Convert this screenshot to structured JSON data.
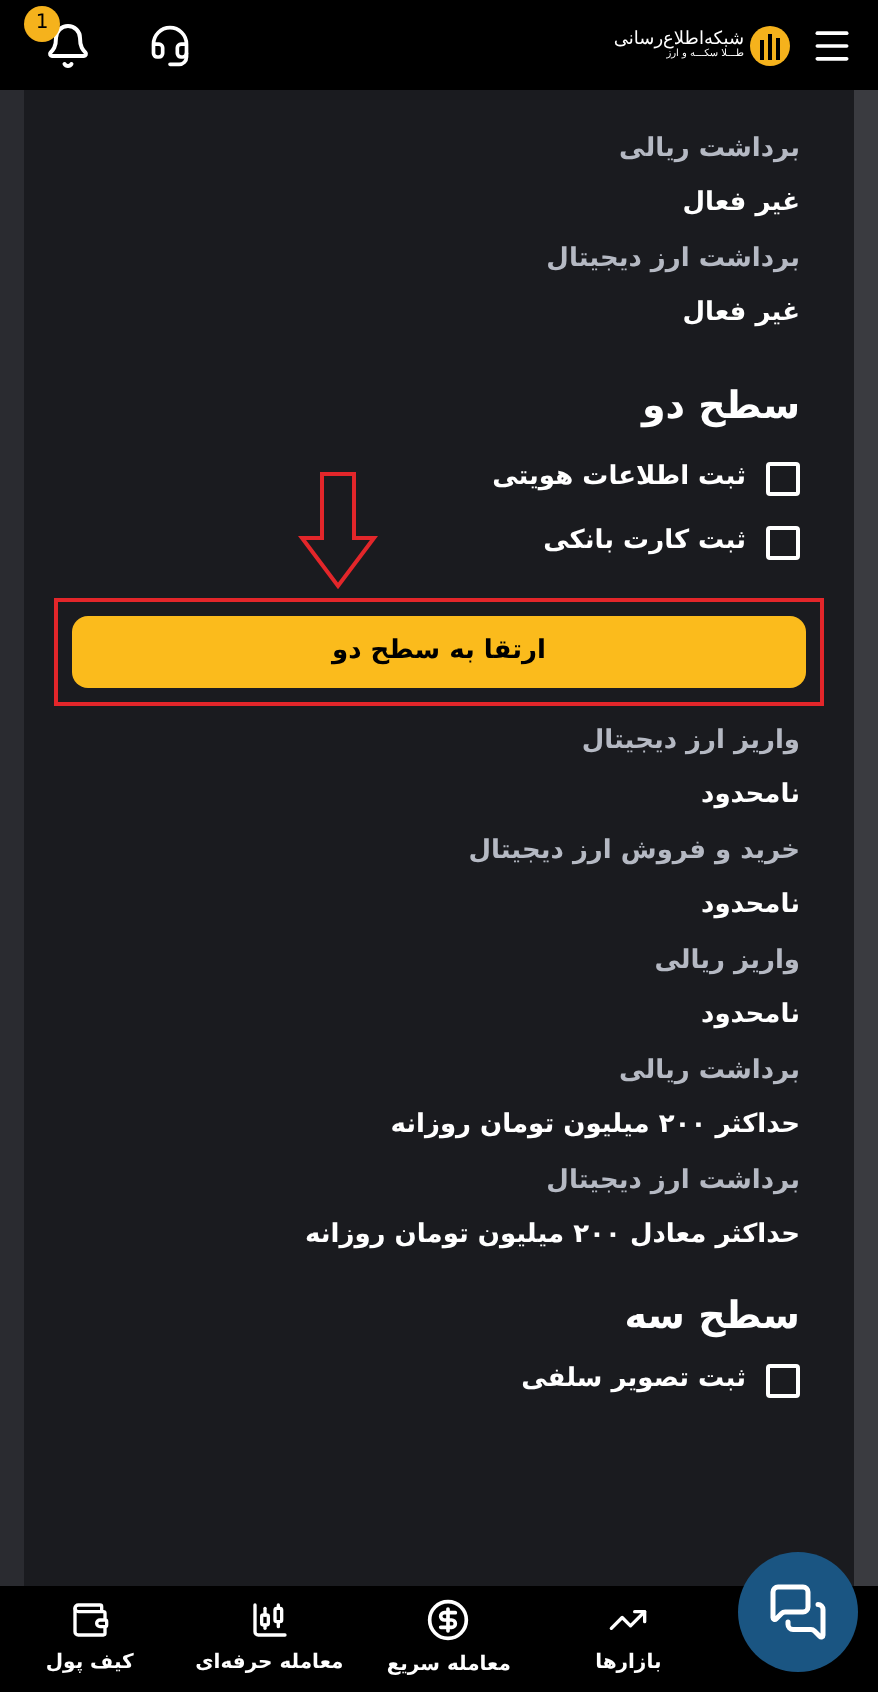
{
  "header": {
    "logo_title": "شبکه‌اطلاع‌رسانی",
    "logo_subtitle": "طـــلا سکـــه و ارز",
    "notification_count": "1"
  },
  "top_fields": [
    {
      "label": "برداشت ریالی",
      "value": "غیر فعال"
    },
    {
      "label": "برداشت ارز دیجیتال",
      "value": "غیر فعال"
    }
  ],
  "level_two": {
    "title": "سطح دو",
    "checklist": [
      {
        "label": "ثبت اطلاعات هویتی",
        "checked": false
      },
      {
        "label": "ثبت کارت بانکی",
        "checked": false
      }
    ],
    "upgrade_button": "ارتقا به سطح دو",
    "fields": [
      {
        "label": "واریز ارز دیجیتال",
        "value": "نامحدود"
      },
      {
        "label": "خرید و فروش ارز دیجیتال",
        "value": "نامحدود"
      },
      {
        "label": "واریز ریالی",
        "value": "نامحدود"
      },
      {
        "label": "برداشت ریالی",
        "value": "حداکثر ۲۰۰ میلیون تومان روزانه"
      },
      {
        "label": "برداشت ارز دیجیتال",
        "value": "حداکثر معادل ۲۰۰ میلیون تومان روزانه"
      }
    ]
  },
  "level_three": {
    "title": "سطح سه",
    "checklist": [
      {
        "label": "ثبت تصویر سلفی",
        "checked": false
      }
    ]
  },
  "bottom_nav": [
    {
      "label": "بازارها",
      "kind": "trend"
    },
    {
      "label": "معامله سریع",
      "kind": "exchange"
    },
    {
      "label": "معامله حرفه‌ای",
      "kind": "candles"
    },
    {
      "label": "کیف پول",
      "kind": "wallet"
    }
  ]
}
